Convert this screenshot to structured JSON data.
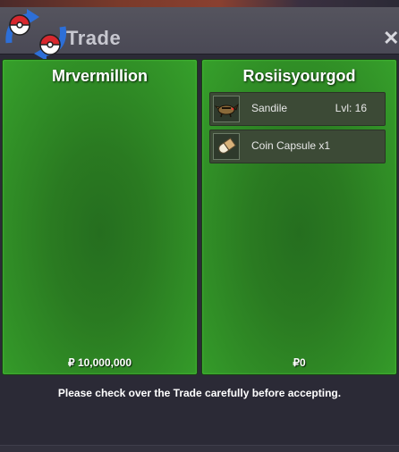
{
  "window": {
    "title": "Trade",
    "close_symbol": "✕"
  },
  "left_panel": {
    "player_name": "Mrvermillion",
    "money": "₽ 10,000,000"
  },
  "right_panel": {
    "player_name": "Rosiisyourgod",
    "money": "₽0",
    "items": [
      {
        "name": "Sandile",
        "level": "Lvl: 16",
        "icon": "sandile-icon"
      },
      {
        "name": "Coin Capsule  x1",
        "level": "",
        "icon": "coin-capsule-icon"
      }
    ]
  },
  "notice": "Please check over the Trade carefully before accepting.",
  "colors": {
    "panel_green": "#2a7a21",
    "panel_edge_green": "#36a02b",
    "titlebar": "#4f4e59",
    "background": "#2b2a36"
  }
}
